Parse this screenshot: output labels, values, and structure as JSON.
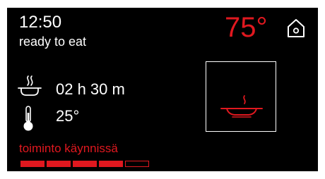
{
  "header": {
    "time": "12:50",
    "status": "ready to eat",
    "oven_temperature": "75°"
  },
  "info": {
    "duration": "02 h 30 m",
    "food_temperature": "25°"
  },
  "program": {
    "icon": "steaming-pan-icon"
  },
  "footer": {
    "function_status": "toiminto käynnissä",
    "progress": {
      "filled_segments": 4,
      "total_segments": 5
    }
  },
  "colors": {
    "background": "#000000",
    "text": "#ffffff",
    "accent": "#e0181f"
  },
  "icons": {
    "home": "home-icon",
    "duration": "steam-dish-icon",
    "temperature": "thermometer-icon"
  }
}
